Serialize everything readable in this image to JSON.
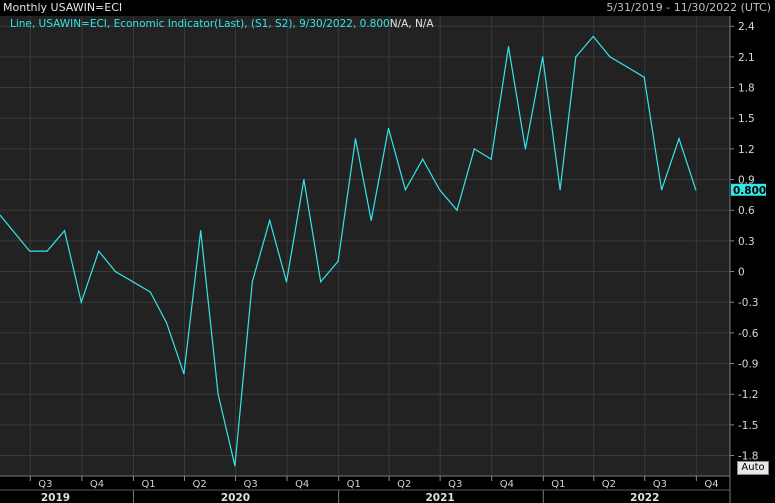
{
  "window": {
    "title": "Monthly USAWIN=ECI",
    "date_range": "5/31/2019 - 11/30/2022 (UTC)"
  },
  "legend_text": "Line, USAWIN=ECI, Economic Indicator(Last), (S1, S2), 9/30/2022, 0.800",
  "legend_suffix": "N/A, N/A",
  "last_value_label": "0.800",
  "auto_label": "Auto",
  "colors": {
    "line": "#33e6e6",
    "background": "#222222",
    "grid": "#3a3a3a"
  },
  "chart_data": {
    "type": "line",
    "series": [
      {
        "x": [
          "2019-05-31",
          "2019-06-30",
          "2019-07-31",
          "2019-08-31",
          "2019-09-30",
          "2019-10-31",
          "2019-11-30",
          "2019-12-31",
          "2020-01-31",
          "2020-02-29",
          "2020-03-31",
          "2020-04-30",
          "2020-05-31",
          "2020-06-30",
          "2020-07-31",
          "2020-08-31",
          "2020-09-30",
          "2020-10-31",
          "2020-11-30",
          "2020-12-31",
          "2021-01-31",
          "2021-02-28",
          "2021-03-31",
          "2021-04-30",
          "2021-05-31",
          "2021-06-30",
          "2021-07-31",
          "2021-08-31",
          "2021-09-30",
          "2021-10-31",
          "2021-11-30",
          "2021-12-31",
          "2022-01-31",
          "2022-02-28",
          "2022-03-31",
          "2022-04-30",
          "2022-05-31",
          "2022-06-30",
          "2022-07-31",
          "2022-08-31",
          "2022-09-30"
        ],
        "values": [
          0.4,
          0.2,
          0.2,
          0.4,
          -0.3,
          0.2,
          0.0,
          -0.1,
          -0.2,
          -0.5,
          -1.0,
          0.4,
          -1.2,
          -1.9,
          -0.1,
          0.5,
          -0.1,
          0.9,
          -0.1,
          0.1,
          1.3,
          0.5,
          1.4,
          0.8,
          1.1,
          0.8,
          0.6,
          1.2,
          1.1,
          2.2,
          1.2,
          2.1,
          0.8,
          2.1,
          2.3,
          2.1,
          2.0,
          1.9,
          0.8,
          1.3,
          0.8
        ]
      }
    ],
    "x_range": [
      "2019-05-08",
      "2022-11-30"
    ],
    "ylim": [
      -2.0,
      2.5
    ],
    "yticks": [
      "2.4",
      "2.1",
      "1.8",
      "1.5",
      "1.2",
      "0.9",
      "0.6",
      "0.3",
      "0",
      "-0.3",
      "-0.6",
      "-0.9",
      "-1.2",
      "-1.5",
      "-1.8"
    ],
    "ytick_values": [
      2.4,
      2.1,
      1.8,
      1.5,
      1.2,
      0.9,
      0.6,
      0.3,
      0.0,
      -0.3,
      -0.6,
      -0.9,
      -1.2,
      -1.5,
      -1.8
    ],
    "quarter_ticks": [
      {
        "label": "Q3",
        "date": "2019-07-01"
      },
      {
        "label": "Q4",
        "date": "2019-10-01"
      },
      {
        "label": "Q1",
        "date": "2020-01-01"
      },
      {
        "label": "Q2",
        "date": "2020-04-01"
      },
      {
        "label": "Q3",
        "date": "2020-07-01"
      },
      {
        "label": "Q4",
        "date": "2020-10-01"
      },
      {
        "label": "Q1",
        "date": "2021-01-01"
      },
      {
        "label": "Q2",
        "date": "2021-04-01"
      },
      {
        "label": "Q3",
        "date": "2021-07-01"
      },
      {
        "label": "Q4",
        "date": "2021-10-01"
      },
      {
        "label": "Q1",
        "date": "2022-01-01"
      },
      {
        "label": "Q2",
        "date": "2022-04-01"
      },
      {
        "label": "Q3",
        "date": "2022-07-01"
      },
      {
        "label": "Q4",
        "date": "2022-10-01"
      }
    ],
    "year_ticks": [
      {
        "label": "2019",
        "date": "2019-08-15"
      },
      {
        "label": "2020",
        "date": "2020-07-01"
      },
      {
        "label": "2021",
        "date": "2021-07-01"
      },
      {
        "label": "2022",
        "date": "2022-07-01"
      }
    ],
    "grid": true
  }
}
